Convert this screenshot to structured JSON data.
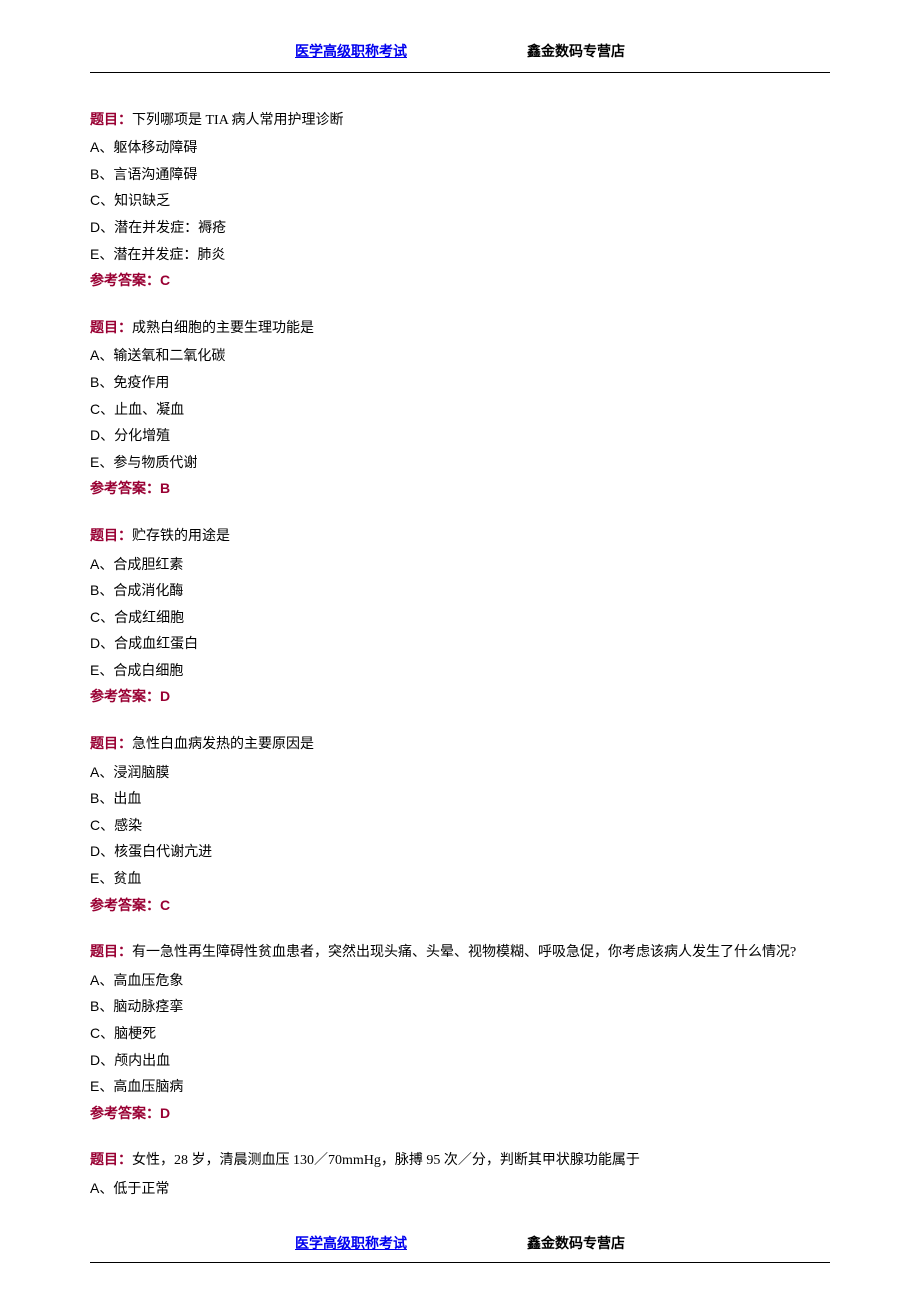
{
  "header": {
    "link": "医学高级职称考试",
    "right": "鑫金数码专营店"
  },
  "questions": [
    {
      "stem_label": "题目：",
      "stem": "下列哪项是 TIA 病人常用护理诊断",
      "options": [
        "A、躯体移动障碍",
        "B、言语沟通障碍",
        "C、知识缺乏",
        "D、潜在并发症：褥疮",
        "E、潜在并发症：肺炎"
      ],
      "answer": "参考答案：C"
    },
    {
      "stem_label": "题目：",
      "stem": "成熟白细胞的主要生理功能是",
      "options": [
        "A、输送氧和二氧化碳",
        "B、免疫作用",
        "C、止血、凝血",
        "D、分化增殖",
        "E、参与物质代谢"
      ],
      "answer": "参考答案：B"
    },
    {
      "stem_label": "题目：",
      "stem": "贮存铁的用途是",
      "options": [
        "A、合成胆红素",
        "B、合成消化酶",
        "C、合成红细胞",
        "D、合成血红蛋白",
        "E、合成白细胞"
      ],
      "answer": "参考答案：D"
    },
    {
      "stem_label": "题目：",
      "stem": "急性白血病发热的主要原因是",
      "options": [
        "A、浸润脑膜",
        "B、出血",
        "C、感染",
        "D、核蛋白代谢亢进",
        "E、贫血"
      ],
      "answer": "参考答案：C"
    },
    {
      "stem_label": "题目：",
      "stem": "有一急性再生障碍性贫血患者，突然出现头痛、头晕、视物模糊、呼吸急促，你考虑该病人发生了什么情况?",
      "options": [
        "A、高血压危象",
        "B、脑动脉痉挛",
        "C、脑梗死",
        "D、颅内出血",
        "E、高血压脑病"
      ],
      "answer": "参考答案：D"
    },
    {
      "stem_label": "题目：",
      "stem": "女性，28 岁，清晨测血压 130／70mmHg，脉搏 95 次／分，判断其甲状腺功能属于",
      "options": [
        "A、低于正常"
      ],
      "answer": null
    }
  ],
  "footer": {
    "link": "医学高级职称考试",
    "right": "鑫金数码专营店"
  }
}
